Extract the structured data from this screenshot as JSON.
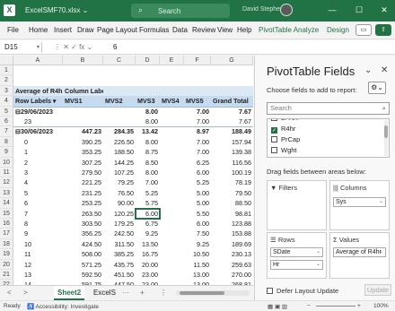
{
  "titlebar": {
    "logo_glyph": "X",
    "doc_title": "ExcelSMF70.xlsx ⌄",
    "search_placeholder": "Search",
    "user_name": "David Stephens",
    "minimize": "—",
    "maximize": "☐",
    "close": "✕"
  },
  "menu": {
    "items": [
      "File",
      "Home",
      "Insert",
      "Draw",
      "Page Layout",
      "Formulas",
      "Data",
      "Review",
      "View",
      "Help",
      "PivotTable Analyze",
      "Design"
    ],
    "comment_glyph": "▭",
    "share_glyph": "⇧"
  },
  "formula": {
    "name_box": "D15",
    "icons": "⋮  ✕  ✓  fx  ⌄",
    "value": "6"
  },
  "grid": {
    "columns": [
      "A",
      "B",
      "C",
      "D",
      "E",
      "F",
      "G"
    ],
    "rows": [
      {
        "n": "1",
        "c": [
          "",
          "",
          "",
          "",
          "",
          "",
          ""
        ]
      },
      {
        "n": "2",
        "c": [
          "",
          "",
          "",
          "",
          "",
          "",
          ""
        ]
      },
      {
        "n": "3",
        "c": [
          "Average of R4hr",
          "Column Labe ▾",
          "",
          "",
          "",
          "",
          ""
        ]
      },
      {
        "n": "4",
        "c": [
          "Row Labels ▾",
          "MVS1",
          "MVS2",
          "MVS3",
          "MVS4",
          "MVS5",
          "Grand Total"
        ]
      },
      {
        "n": "5",
        "c": [
          "⊟29/06/2023",
          "",
          "",
          "8.00",
          "",
          "7.00",
          "7.67"
        ]
      },
      {
        "n": "6",
        "c": [
          "23",
          "",
          "",
          "8.00",
          "",
          "7.00",
          "7.67"
        ]
      },
      {
        "n": "7",
        "c": [
          "⊟30/06/2023",
          "447.23",
          "284.35",
          "13.42",
          "",
          "8.97",
          "188.49"
        ]
      },
      {
        "n": "8",
        "c": [
          "0",
          "390.25",
          "226.50",
          "8.00",
          "",
          "7.00",
          "157.94"
        ]
      },
      {
        "n": "9",
        "c": [
          "1",
          "353.25",
          "188.50",
          "8.75",
          "",
          "7.00",
          "139.38"
        ]
      },
      {
        "n": "10",
        "c": [
          "2",
          "307.25",
          "144.25",
          "8.50",
          "",
          "6.25",
          "116.56"
        ]
      },
      {
        "n": "11",
        "c": [
          "3",
          "279.50",
          "107.25",
          "8.00",
          "",
          "6.00",
          "100.19"
        ]
      },
      {
        "n": "12",
        "c": [
          "4",
          "221.25",
          "79.25",
          "7.00",
          "",
          "5.25",
          "78.19"
        ]
      },
      {
        "n": "13",
        "c": [
          "5",
          "231.25",
          "76.50",
          "5.25",
          "",
          "5.00",
          "79.50"
        ]
      },
      {
        "n": "14",
        "c": [
          "6",
          "253.25",
          "90.00",
          "5.75",
          "",
          "5.00",
          "88.50"
        ]
      },
      {
        "n": "15",
        "c": [
          "7",
          "263.50",
          "120.25",
          "6.00",
          "",
          "5.50",
          "98.81"
        ]
      },
      {
        "n": "16",
        "c": [
          "8",
          "303.50",
          "179.25",
          "6.75",
          "",
          "6.00",
          "123.88"
        ]
      },
      {
        "n": "17",
        "c": [
          "9",
          "356.25",
          "242.50",
          "9.25",
          "",
          "7.50",
          "153.88"
        ]
      },
      {
        "n": "18",
        "c": [
          "10",
          "424.50",
          "311.50",
          "13.50",
          "",
          "9.25",
          "189.69"
        ]
      },
      {
        "n": "19",
        "c": [
          "11",
          "508.00",
          "385.25",
          "16.75",
          "",
          "10.50",
          "230.13"
        ]
      },
      {
        "n": "20",
        "c": [
          "12",
          "571.25",
          "435.75",
          "20.00",
          "",
          "11.50",
          "259.63"
        ]
      },
      {
        "n": "21",
        "c": [
          "13",
          "592.50",
          "451.50",
          "23.00",
          "",
          "13.00",
          "270.00"
        ]
      },
      {
        "n": "22",
        "c": [
          "14",
          "591.75",
          "447.50",
          "23.00",
          "",
          "13.00",
          "268.81"
        ]
      }
    ]
  },
  "tabs": {
    "nav_prev": "<",
    "nav_next": ">",
    "sheets": [
      "Sheet2",
      "ExcelS"
    ],
    "more": "···",
    "add": "+",
    "options": "⋮"
  },
  "status": {
    "ready": "Ready",
    "accessibility": "♿ Accessibility: Investigate",
    "view_icons": "▦  ▣  ▥",
    "zoom_minus": "−",
    "zoom_plus": "+",
    "zoom": "100%"
  },
  "pane": {
    "title": "PivotTable Fields",
    "chevron": "⌄",
    "close": "✕",
    "subtitle": "Choose fields to add to report:",
    "gear_glyph": "⚙⌄",
    "search_placeholder": "Search",
    "search_glyph": "⌕",
    "fields": [
      {
        "label": "LPAR",
        "checked": false
      },
      {
        "label": "R4hr",
        "checked": true
      },
      {
        "label": "PrCap",
        "checked": false
      },
      {
        "label": "Wght",
        "checked": false
      }
    ],
    "drag_label": "Drag fields between areas below:",
    "filters_label": "Filters",
    "columns_label": "Columns",
    "rows_label": "Rows",
    "values_label": "Values",
    "filters_icon": "▼",
    "columns_icon": "|||",
    "rows_icon": "☰",
    "values_icon": "Σ",
    "column_fields": [
      "Sys"
    ],
    "row_fields": [
      "SDate",
      "Hr"
    ],
    "value_fields": [
      "Average of R4hr"
    ],
    "defer_label": "Defer Layout Update",
    "update_label": "Update"
  },
  "colors": {
    "brand": "#217346",
    "pivot_header": "#dce9f5",
    "pivot_header_dark": "#c6dbef"
  }
}
